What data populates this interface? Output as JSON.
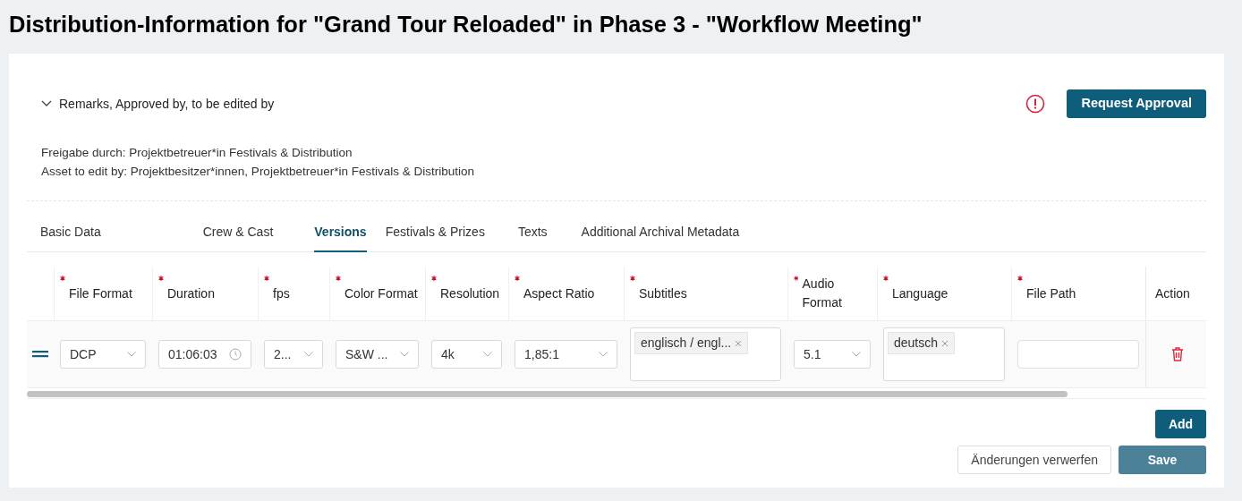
{
  "page_title": "Distribution-Information for \"Grand Tour Reloaded\" in Phase 3 - \"Workflow Meeting\"",
  "remarks": {
    "title": "Remarks, Approved by, to be edited by",
    "expanded": true,
    "lines": [
      "Freigabe durch: Projektbetreuer*in Festivals & Distribution",
      "Asset to edit by: Projektbesitzer*innen, Projektbetreuer*in Festivals & Distribution"
    ]
  },
  "request_approval": {
    "label": "Request Approval",
    "warning": true
  },
  "tabs": [
    {
      "label": "Basic Data",
      "selected": false
    },
    {
      "label": "Crew & Cast",
      "selected": false
    },
    {
      "label": "Versions",
      "selected": true
    },
    {
      "label": "Festivals & Prizes",
      "selected": false
    },
    {
      "label": "Texts",
      "selected": false
    },
    {
      "label": "Additional Archival Metadata",
      "selected": false
    }
  ],
  "table": {
    "columns": [
      {
        "label": "File Format",
        "required": true
      },
      {
        "label": "Duration",
        "required": true
      },
      {
        "label": "fps",
        "required": true
      },
      {
        "label": "Color Format",
        "required": true
      },
      {
        "label": "Resolution",
        "required": true
      },
      {
        "label": "Aspect Ratio",
        "required": true
      },
      {
        "label": "Subtitles",
        "required": true
      },
      {
        "label": "Audio Format",
        "required": true
      },
      {
        "label": "Language",
        "required": true
      },
      {
        "label": "File Path",
        "required": true
      },
      {
        "label": "Action",
        "required": false
      }
    ],
    "rows": [
      {
        "cells": [
          {
            "kind": "select",
            "value": "DCP"
          },
          {
            "kind": "time",
            "value": "01:06:03"
          },
          {
            "kind": "select",
            "value": "2..."
          },
          {
            "kind": "select",
            "value": "S&W ..."
          },
          {
            "kind": "select",
            "value": "4k"
          },
          {
            "kind": "select",
            "value": "1,85:1"
          },
          {
            "kind": "tags",
            "tags": [
              "englisch / engl..."
            ]
          },
          {
            "kind": "select",
            "value": "5.1"
          },
          {
            "kind": "tags",
            "tags": [
              "deutsch"
            ]
          },
          {
            "kind": "text"
          },
          {
            "kind": "delete"
          }
        ]
      }
    ]
  },
  "buttons": {
    "add": "Add",
    "discard": "Änderungen verwerfen",
    "save": {
      "label": "Save",
      "disabled": true
    }
  }
}
